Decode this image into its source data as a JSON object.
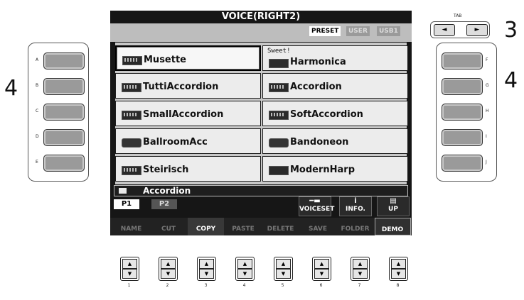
{
  "header": {
    "title": "VOICE(RIGHT2)"
  },
  "banks": [
    {
      "label": "PRESET",
      "active": true
    },
    {
      "label": "USER",
      "active": false
    },
    {
      "label": "USB1",
      "active": false
    }
  ],
  "voices": [
    {
      "label": "Musette",
      "sub": "",
      "icon": "accordion-icon",
      "selected": true
    },
    {
      "label": "Harmonica",
      "sub": "Sweet!",
      "icon": "harmonica-icon",
      "selected": false
    },
    {
      "label": "TuttiAccordion",
      "sub": "",
      "icon": "accordion-icon",
      "selected": false
    },
    {
      "label": "Accordion",
      "sub": "",
      "icon": "accordion-icon",
      "selected": false
    },
    {
      "label": "SmallAccordion",
      "sub": "",
      "icon": "accordion-icon",
      "selected": false
    },
    {
      "label": "SoftAccordion",
      "sub": "",
      "icon": "accordion-icon",
      "selected": false
    },
    {
      "label": "BallroomAcc",
      "sub": "",
      "icon": "bandoneon-icon",
      "selected": false
    },
    {
      "label": "Bandoneon",
      "sub": "",
      "icon": "bandoneon-icon",
      "selected": false
    },
    {
      "label": "Steirisch",
      "sub": "",
      "icon": "accordion-icon",
      "selected": false
    },
    {
      "label": "ModernHarp",
      "sub": "",
      "icon": "harmonica-icon",
      "selected": false
    }
  ],
  "folder": {
    "label": "Accordion"
  },
  "pages": [
    {
      "label": "P1",
      "active": true
    },
    {
      "label": "P2",
      "active": false
    }
  ],
  "function_buttons": [
    {
      "label": "VOICESET",
      "glyph": "━▬"
    },
    {
      "label": "INFO.",
      "glyph": "i"
    },
    {
      "label": "UP",
      "glyph": "▤"
    }
  ],
  "bottom_menu": [
    {
      "label": "NAME",
      "active": false
    },
    {
      "label": "CUT",
      "active": false
    },
    {
      "label": "COPY",
      "active": true
    },
    {
      "label": "PASTE",
      "active": false
    },
    {
      "label": "DELETE",
      "active": false
    },
    {
      "label": "SAVE",
      "active": false
    },
    {
      "label": "FOLDER",
      "active": false
    },
    {
      "label": "DEMO",
      "active": true
    }
  ],
  "left_buttons": [
    "A",
    "B",
    "C",
    "D",
    "E"
  ],
  "right_buttons": [
    "F",
    "G",
    "H",
    "I",
    "J"
  ],
  "tab": {
    "label": "TAB",
    "prev": "◄",
    "next": "►"
  },
  "callouts": {
    "tab": "3",
    "left": "4",
    "right": "4"
  },
  "number_buttons": [
    "1",
    "2",
    "3",
    "4",
    "5",
    "6",
    "7",
    "8"
  ],
  "arrows": {
    "up": "▲",
    "down": "▼"
  }
}
